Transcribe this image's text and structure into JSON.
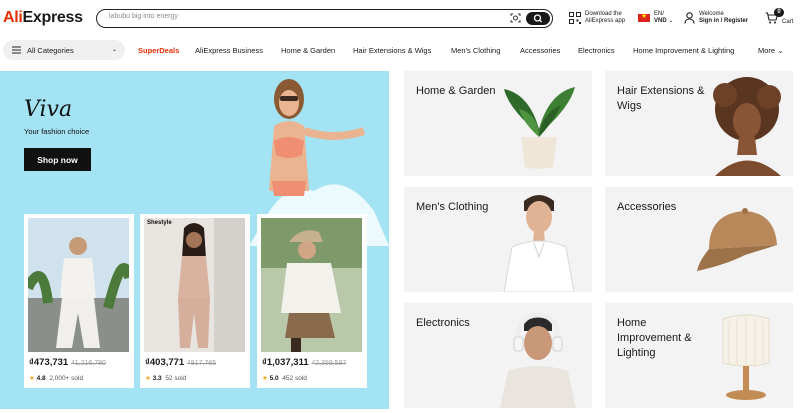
{
  "header": {
    "logo_prefix": "Ali",
    "logo_suffix": "Express",
    "search_placeholder": "labubu big into energy",
    "app_line1": "Download the",
    "app_line2": "AliExpress app",
    "lang": "EN/",
    "currency": "VND",
    "welcome": "Welcome",
    "signin": "Sign in / Register",
    "cart_count": "0",
    "cart_label": "Cart"
  },
  "nav": {
    "all_categories": "All Categories",
    "items": [
      "SuperDeals",
      "AliExpress Business",
      "Home & Garden",
      "Hair Extensions & Wigs",
      "Men's Clothing",
      "Accessories",
      "Electronics",
      "Home Improvement & Lighting",
      "More"
    ]
  },
  "hero": {
    "title": "Viva",
    "tagline": "Your fashion choice",
    "cta": "Shop now",
    "products": [
      {
        "price": "₫473,731",
        "old_price": "₫1,216,780",
        "rating": "4.8",
        "sold": "2,000+ sold"
      },
      {
        "price": "₫403,771",
        "old_price": "₫917,765",
        "rating": "3.3",
        "sold": "52 sold",
        "brand": "Shestyle"
      },
      {
        "price": "₫1,037,311",
        "old_price": "₫2,359,597",
        "rating": "5.0",
        "sold": "452 sold"
      }
    ]
  },
  "categories": [
    {
      "label": "Home & Garden",
      "icon": "plant-pot"
    },
    {
      "label": "Hair Extensions & Wigs",
      "icon": "curly-hair-model"
    },
    {
      "label": "Men's Clothing",
      "icon": "male-model"
    },
    {
      "label": "Accessories",
      "icon": "baseball-cap"
    },
    {
      "label": "Electronics",
      "icon": "headphones-model"
    },
    {
      "label": "Home Improvement & Lighting",
      "icon": "table-lamp"
    }
  ],
  "colors": {
    "brand_red": "#e62e04",
    "hero_bg": "#a4e3f3",
    "tile_bg": "#f3f3f3",
    "text": "#191919"
  }
}
